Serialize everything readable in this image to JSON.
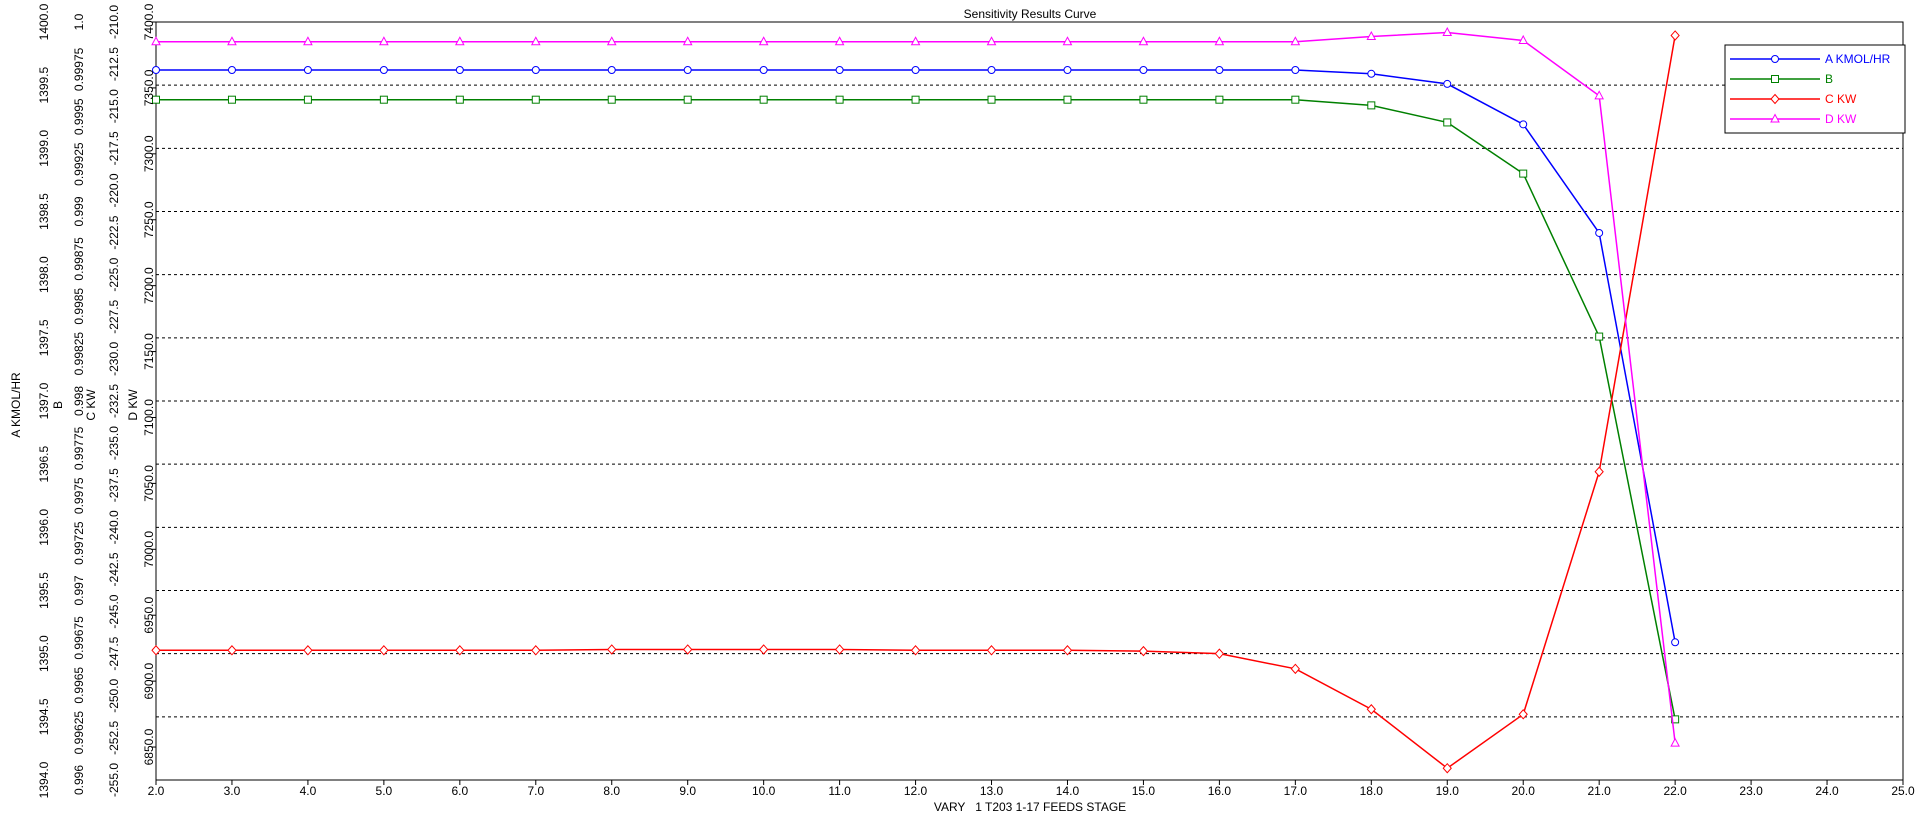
{
  "chart_data": {
    "type": "line",
    "title": "Sensitivity Results Curve",
    "xlabel": "VARY   1 T203 1-17 FEEDS STAGE",
    "xlim": [
      2.0,
      25.0
    ],
    "x_ticks": [
      2.0,
      3.0,
      4.0,
      5.0,
      6.0,
      7.0,
      8.0,
      9.0,
      10.0,
      11.0,
      12.0,
      13.0,
      14.0,
      15.0,
      16.0,
      17.0,
      18.0,
      19.0,
      20.0,
      21.0,
      22.0,
      23.0,
      24.0,
      25.0
    ],
    "x_tick_labels": [
      "2.0",
      "3.0",
      "4.0",
      "5.0",
      "6.0",
      "7.0",
      "8.0",
      "9.0",
      "10.0",
      "11.0",
      "12.0",
      "13.0",
      "14.0",
      "15.0",
      "16.0",
      "17.0",
      "18.0",
      "19.0",
      "20.0",
      "21.0",
      "22.0",
      "23.0",
      "24.0",
      "25.0"
    ],
    "x": [
      2,
      3,
      4,
      5,
      6,
      7,
      8,
      9,
      10,
      11,
      12,
      13,
      14,
      15,
      16,
      17,
      18,
      19,
      20,
      21,
      22
    ],
    "grid": "horizontal dashed",
    "legend_position": "top-right",
    "axes": [
      {
        "label": "A KMOL/HR",
        "range": [
          1394.0,
          1400.0
        ],
        "ticks": [
          "1394.0",
          "1394.5",
          "1395.0",
          "1395.5",
          "1396.0",
          "1396.5",
          "1397.0",
          "1397.5",
          "1398.0",
          "1398.5",
          "1399.0",
          "1399.5",
          "1400.0"
        ]
      },
      {
        "label": "B",
        "range": [
          0.996,
          1.0
        ],
        "ticks": [
          "0.996",
          "0.99625",
          "0.9965",
          "0.99675",
          "0.997",
          "0.99725",
          "0.9975",
          "0.99775",
          "0.998",
          "0.99825",
          "0.9985",
          "0.99875",
          "0.999",
          "0.99925",
          "0.9995",
          "0.99975",
          "1.0"
        ]
      },
      {
        "label": "C KW",
        "range": [
          -255.0,
          -210.0
        ],
        "ticks": [
          "-255.0",
          "-252.5",
          "-250.0",
          "-247.5",
          "-245.0",
          "-242.5",
          "-240.0",
          "-237.5",
          "-235.0",
          "-232.5",
          "-230.0",
          "-227.5",
          "-225.0",
          "-222.5",
          "-220.0",
          "-217.5",
          "-215.0",
          "-212.5",
          "-210.0"
        ]
      },
      {
        "label": "D KW",
        "range": [
          6825.0,
          7400.0
        ],
        "ticks": [
          "6850.0",
          "6900.0",
          "6950.0",
          "7000.0",
          "7050.0",
          "7100.0",
          "7150.0",
          "7200.0",
          "7250.0",
          "7300.0",
          "7350.0",
          "7400.0"
        ]
      }
    ],
    "series": [
      {
        "name": "A KMOL/HR",
        "axis": 0,
        "color": "#0000ff",
        "marker": "circle",
        "values": [
          1399.62,
          1399.62,
          1399.62,
          1399.62,
          1399.62,
          1399.62,
          1399.62,
          1399.62,
          1399.62,
          1399.62,
          1399.62,
          1399.62,
          1399.62,
          1399.62,
          1399.62,
          1399.62,
          1399.59,
          1399.51,
          1399.19,
          1398.33,
          1395.09
        ]
      },
      {
        "name": "B",
        "axis": 1,
        "color": "#008000",
        "marker": "square",
        "values": [
          0.99959,
          0.99959,
          0.99959,
          0.99959,
          0.99959,
          0.99959,
          0.99959,
          0.99959,
          0.99959,
          0.99959,
          0.99959,
          0.99959,
          0.99959,
          0.99959,
          0.99959,
          0.99959,
          0.99956,
          0.99947,
          0.9992,
          0.99834,
          0.99632
        ]
      },
      {
        "name": "C KW",
        "axis": 2,
        "color": "#ff0000",
        "marker": "diamond",
        "values": [
          -247.3,
          -247.3,
          -247.3,
          -247.3,
          -247.3,
          -247.3,
          -247.25,
          -247.25,
          -247.25,
          -247.25,
          -247.3,
          -247.3,
          -247.3,
          -247.35,
          -247.5,
          -248.4,
          -250.8,
          -254.3,
          -251.1,
          -236.7,
          -210.8
        ]
      },
      {
        "name": "D KW",
        "axis": 3,
        "color": "#ff00ff",
        "marker": "triangle",
        "values": [
          7385.0,
          7385.0,
          7385.0,
          7385.0,
          7385.0,
          7385.0,
          7385.0,
          7385.0,
          7385.0,
          7385.0,
          7385.0,
          7385.0,
          7385.0,
          7385.0,
          7385.0,
          7385.0,
          7389.0,
          7392.0,
          7386.0,
          7344.0,
          6853.0
        ]
      }
    ]
  }
}
